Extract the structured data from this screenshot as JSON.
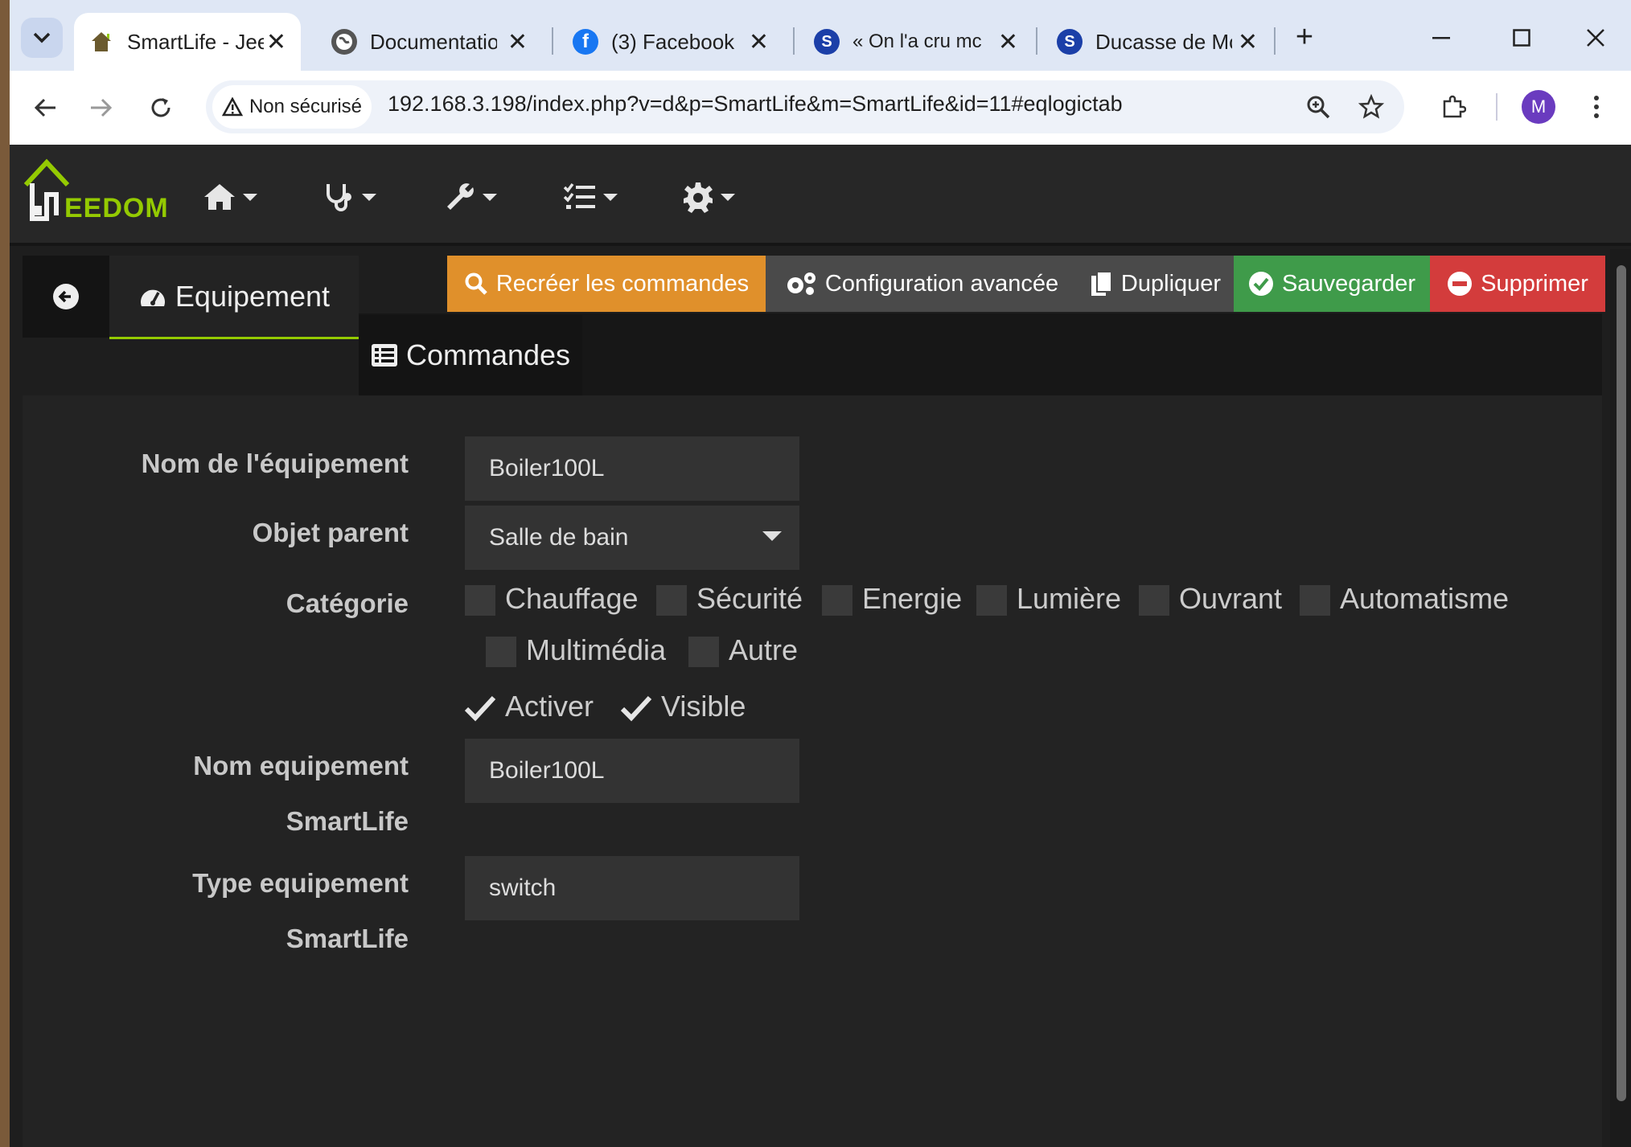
{
  "browser": {
    "tabs": [
      {
        "title": "SmartLife - Jee",
        "active": true
      },
      {
        "title": "Documentation",
        "active": false
      },
      {
        "title": "(3) Facebook",
        "active": false
      },
      {
        "title": "« On l'a cru mc",
        "active": false
      },
      {
        "title": "Ducasse de Mc",
        "active": false
      }
    ],
    "security_label": "Non sécurisé",
    "url": "192.168.3.198/index.php?v=d&p=SmartLife&m=SmartLife&id=11#eqlogictab",
    "profile_initial": "M"
  },
  "app": {
    "logo_text": "EEDOM",
    "tabs": {
      "equipement": "Equipement",
      "commandes": "Commandes"
    },
    "actions": {
      "recreate": "Recréer les commandes",
      "advanced": "Configuration avancée",
      "duplicate": "Dupliquer",
      "save": "Sauvegarder",
      "delete": "Supprimer"
    },
    "colors": {
      "recreate": "#e0902b",
      "advanced": "#4a4a4a",
      "duplicate": "#4a4a4a",
      "save": "#3f9b4a",
      "delete": "#d33c3c",
      "accent": "#94ca02"
    }
  },
  "form": {
    "name_label": "Nom de l'équipement",
    "name_value": "Boiler100L",
    "parent_label": "Objet parent",
    "parent_value": "Salle de bain",
    "category_label": "Catégorie",
    "categories": [
      "Chauffage",
      "Sécurité",
      "Energie",
      "Lumière",
      "Ouvrant",
      "Automatisme",
      "Multimédia",
      "Autre"
    ],
    "enable_label": "Activer",
    "enable_checked": true,
    "visible_label": "Visible",
    "visible_checked": true,
    "smartlife_name_label_1": "Nom equipement",
    "smartlife_name_label_2": "SmartLife",
    "smartlife_name_value": "Boiler100L",
    "smartlife_type_label_1": "Type equipement",
    "smartlife_type_label_2": "SmartLife",
    "smartlife_type_value": "switch"
  }
}
